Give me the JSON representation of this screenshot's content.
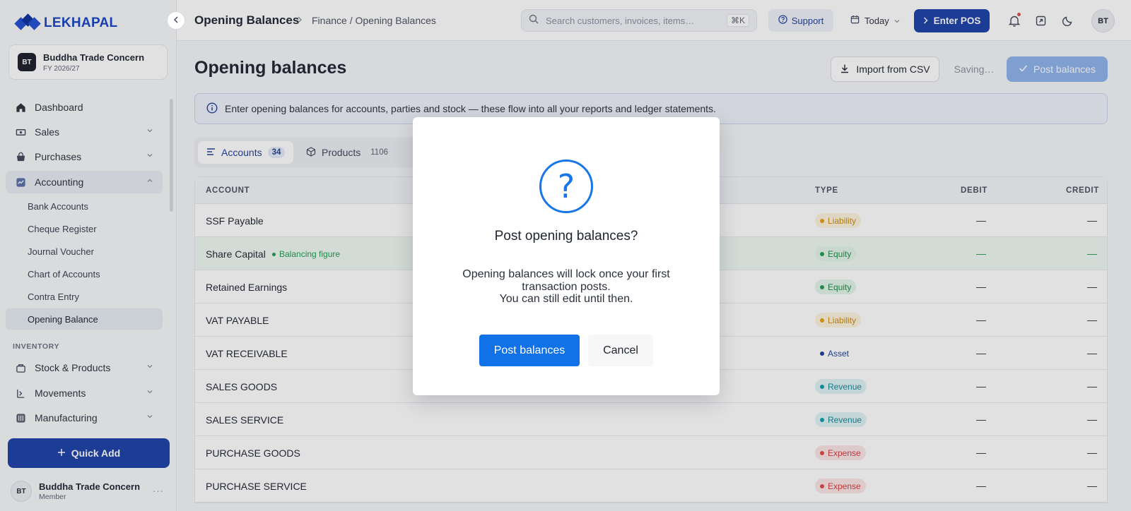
{
  "brand": {
    "name": "LEKHAPAL"
  },
  "org": {
    "badge": "BT",
    "name": "Buddha Trade Concern",
    "fy": "FY 2026/27"
  },
  "sidebar": {
    "items": [
      {
        "label": "Dashboard",
        "icon": "home-icon"
      },
      {
        "label": "Sales",
        "icon": "sales-icon"
      },
      {
        "label": "Purchases",
        "icon": "purchases-icon"
      },
      {
        "label": "Accounting",
        "icon": "accounting-icon"
      }
    ],
    "accounting_sub": [
      "Bank Accounts",
      "Cheque Register",
      "Journal Voucher",
      "Chart of Accounts",
      "Contra Entry",
      "Opening Balance"
    ],
    "inventory_label": "INVENTORY",
    "inventory_items": [
      {
        "label": "Stock & Products",
        "icon": "stock-icon"
      },
      {
        "label": "Movements",
        "icon": "movements-icon"
      },
      {
        "label": "Manufacturing",
        "icon": "manufacturing-icon"
      }
    ],
    "quick_add": "Quick Add",
    "user": {
      "initials": "BT",
      "name": "Buddha Trade Concern",
      "role": "Member"
    }
  },
  "topbar": {
    "title": "Opening Balances",
    "breadcrumb": "Finance / Opening Balances",
    "search_placeholder": "Search customers, invoices, items…",
    "search_shortcut": "⌘K",
    "support": "Support",
    "date_filter": "Today",
    "enter_pos": "Enter POS",
    "avatar": "BT"
  },
  "page": {
    "title": "Opening balances",
    "import_label": "Import from CSV",
    "saving_label": "Saving…",
    "post_label": "Post balances",
    "info": "Enter opening balances for accounts, parties and stock — these flow into all your reports and ledger statements."
  },
  "tabs": [
    {
      "label": "Accounts",
      "count": "34"
    },
    {
      "label": "Products",
      "count": "1106"
    }
  ],
  "table": {
    "headers": {
      "account": "ACCOUNT",
      "type": "TYPE",
      "debit": "DEBIT",
      "credit": "CREDIT"
    },
    "balancing_tag": "Balancing figure",
    "rows": [
      {
        "account": "SSF Payable",
        "type": "Liability",
        "debit": "—",
        "credit": "—"
      },
      {
        "account": "Share Capital",
        "type": "Equity",
        "debit": "—",
        "credit": "—"
      },
      {
        "account": "Retained Earnings",
        "type": "Equity",
        "debit": "—",
        "credit": "—"
      },
      {
        "account": "VAT PAYABLE",
        "type": "Liability",
        "debit": "—",
        "credit": "—"
      },
      {
        "account": "VAT RECEIVABLE",
        "type": "Asset",
        "debit": "—",
        "credit": "—"
      },
      {
        "account": "SALES GOODS",
        "type": "Revenue",
        "debit": "—",
        "credit": "—"
      },
      {
        "account": "SALES SERVICE",
        "type": "Revenue",
        "debit": "—",
        "credit": "—"
      },
      {
        "account": "PURCHASE GOODS",
        "type": "Expense",
        "debit": "—",
        "credit": "—"
      },
      {
        "account": "PURCHASE SERVICE",
        "type": "Expense",
        "debit": "—",
        "credit": "—"
      }
    ]
  },
  "modal": {
    "icon": "?",
    "title": "Post opening balances?",
    "body_line1": "Opening balances will lock once your first transaction posts.",
    "body_line2": "You can still edit until then.",
    "confirm": "Post balances",
    "cancel": "Cancel"
  },
  "colors": {
    "primary": "#1b3fa6",
    "modal_accent": "#1171e6",
    "liability": "#e3a008",
    "equity": "#1f9d4c",
    "revenue": "#159aa8",
    "expense": "#e04848"
  }
}
